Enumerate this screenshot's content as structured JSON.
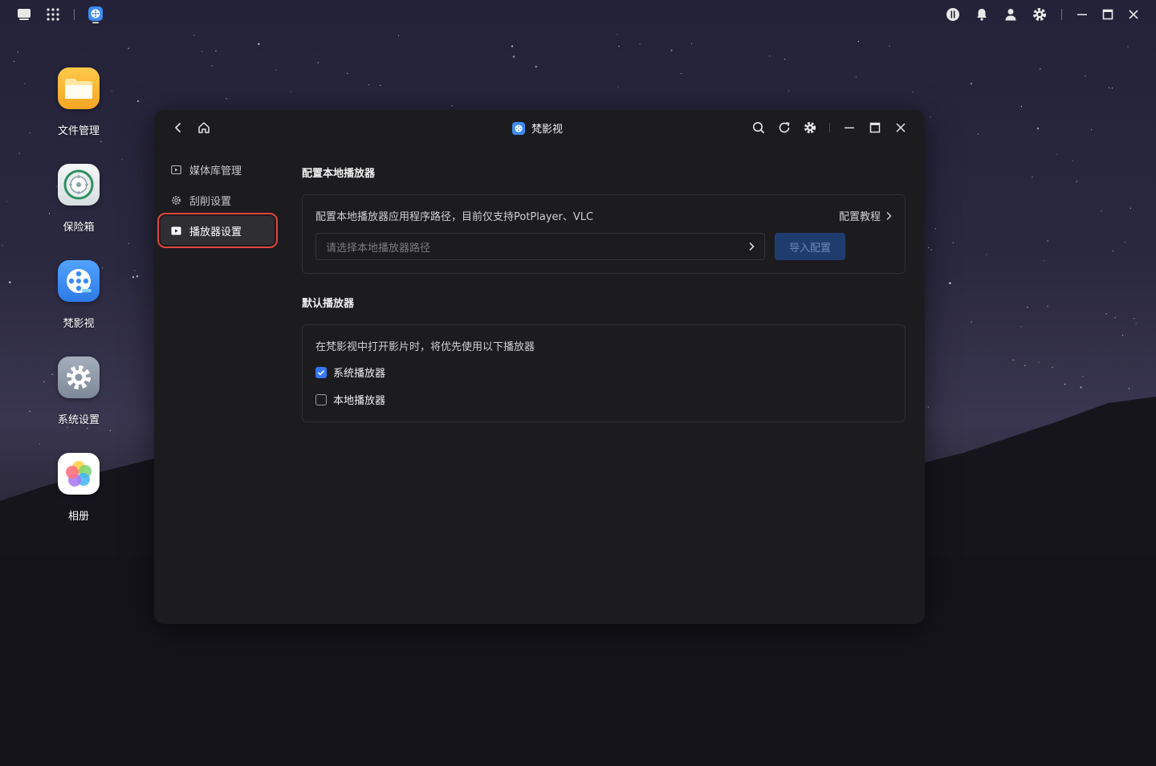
{
  "taskbar": {
    "left_icons": [
      "desktop-icon",
      "app-grid-icon",
      "fanyingshi-app-icon"
    ],
    "right_icons": [
      "power-icon",
      "bell-icon",
      "user-icon",
      "gear-icon"
    ],
    "window_controls": [
      "minimize-icon",
      "maximize-icon",
      "close-icon"
    ]
  },
  "desktop": {
    "icons": [
      {
        "label": "文件管理",
        "icon": "folder-icon",
        "color": "#f7b733"
      },
      {
        "label": "保险箱",
        "icon": "safe-icon",
        "color": "#e9eef0"
      },
      {
        "label": "梵影视",
        "icon": "film-reel-icon",
        "color": "#3d8bf2"
      },
      {
        "label": "系统设置",
        "icon": "gear-icon",
        "color": "#8a96a8"
      },
      {
        "label": "相册",
        "icon": "photos-icon",
        "color": "#ffffff"
      }
    ]
  },
  "window": {
    "title": "梵影视",
    "header_icons": [
      "back-icon",
      "home-icon",
      "search-icon",
      "refresh-icon",
      "gear-icon",
      "minimize-icon",
      "maximize-icon",
      "close-icon"
    ],
    "sidebar": {
      "items": [
        {
          "label": "媒体库管理",
          "icon": "media-library-icon",
          "active": false
        },
        {
          "label": "刮削设置",
          "icon": "scrape-settings-icon",
          "active": false
        },
        {
          "label": "播放器设置",
          "icon": "player-icon",
          "active": true
        }
      ]
    },
    "local_player": {
      "title": "配置本地播放器",
      "description": "配置本地播放器应用程序路径，目前仅支持PotPlayer、VLC",
      "tutorial_link": "配置教程",
      "path_placeholder": "请选择本地播放器路径",
      "import_button": "导入配置"
    },
    "default_player": {
      "title": "默认播放器",
      "description": "在梵影视中打开影片时，将优先使用以下播放器",
      "options": [
        {
          "label": "系统播放器",
          "checked": true
        },
        {
          "label": "本地播放器",
          "checked": false
        }
      ]
    }
  },
  "colors": {
    "accent": "#3478f6",
    "highlight_outline": "#e0453a",
    "window_bg": "#1c1c1f"
  }
}
